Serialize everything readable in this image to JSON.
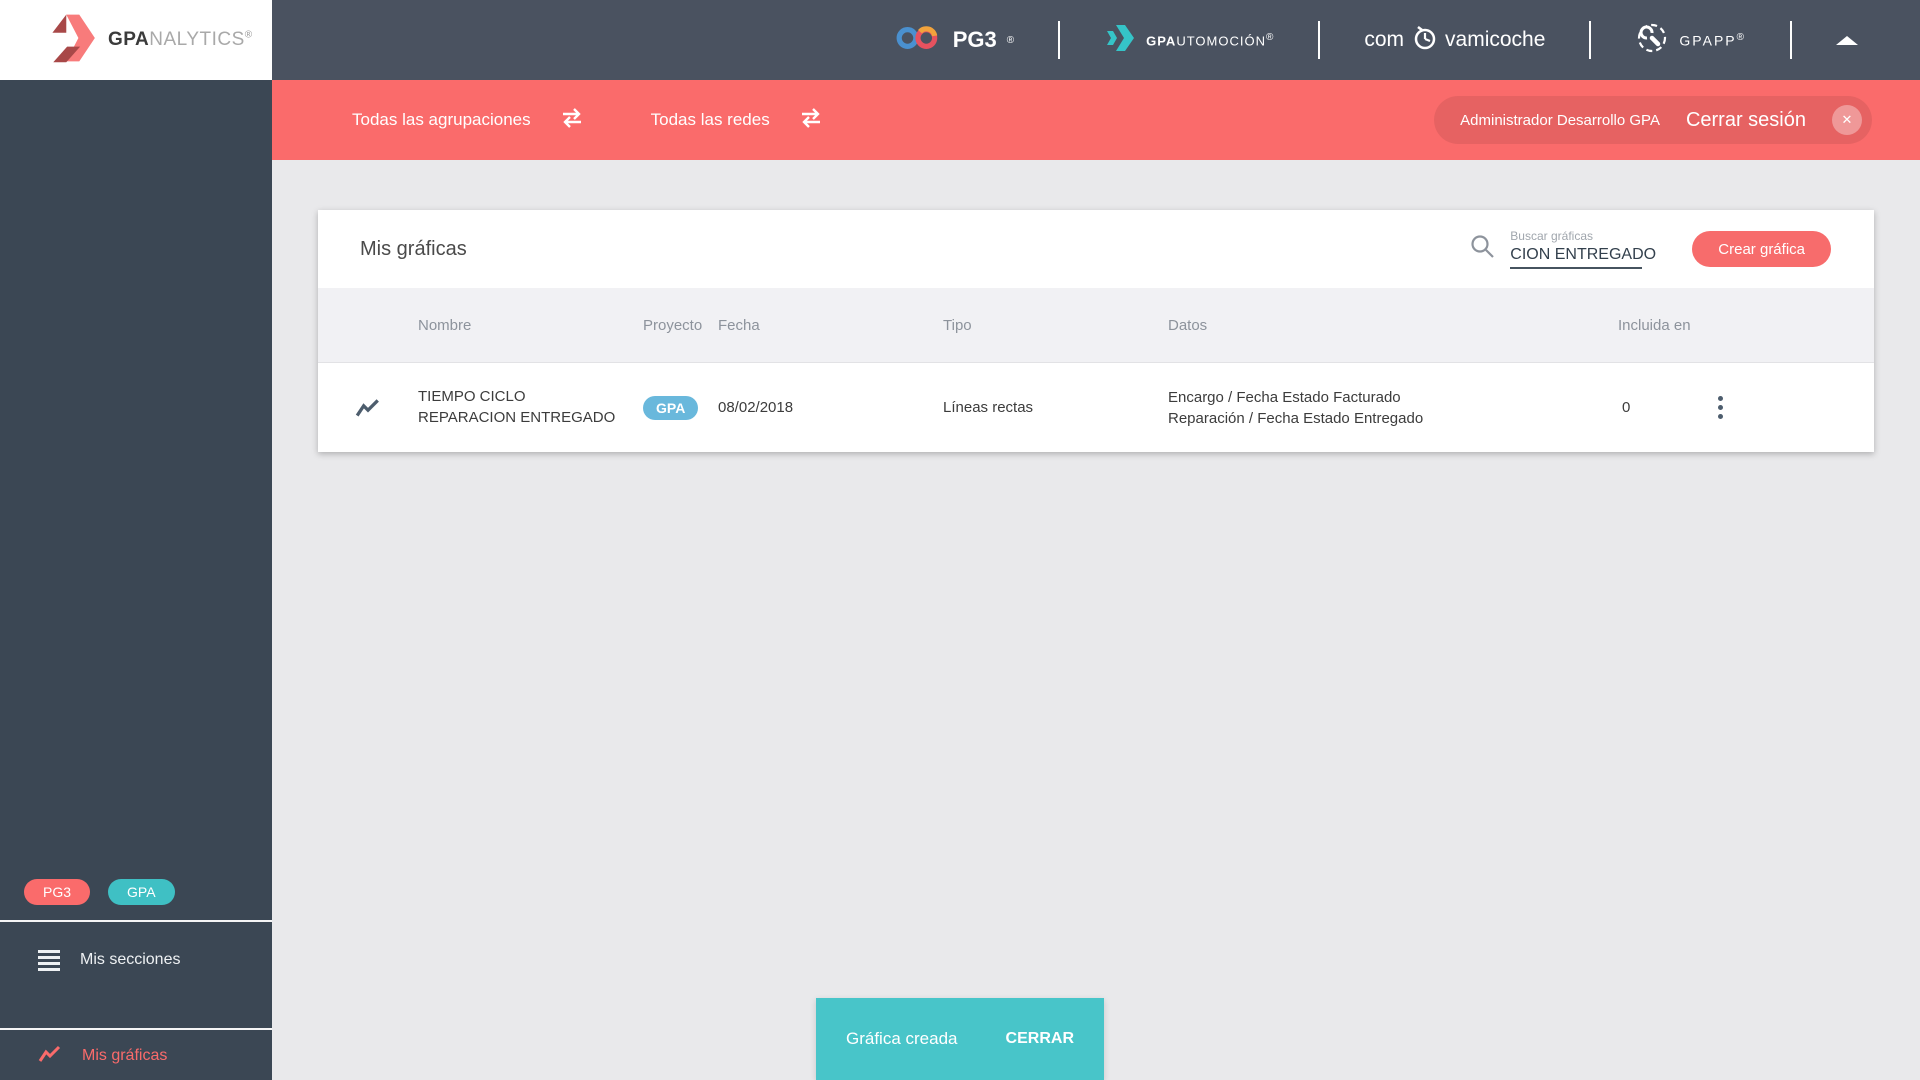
{
  "logo_box": {
    "bold": "GPA",
    "light": "NALYTICS",
    "registered": "®"
  },
  "topbar": {
    "pg3_label": "PG3",
    "pg3_registered": "®",
    "gpautomocion_bold": "GPA",
    "gpautomocion_rest": "UTOMOCIÓN",
    "gpautomocion_registered": "®",
    "comyovamicoche_prefix": "com",
    "comyovamicoche_suffix": "vamicoche",
    "gpapp_label": "GPAPP",
    "gpapp_registered": "®"
  },
  "filterbar": {
    "groupings": "Todas las agrupaciones",
    "networks": "Todas las redes",
    "user": "Administrador Desarrollo GPA",
    "logout": "Cerrar sesión",
    "close_glyph": "✕"
  },
  "sidebar": {
    "badge_pg3": "PG3",
    "badge_gpa": "GPA",
    "item_sections": "Mis secciones",
    "item_charts": "Mis gráficas"
  },
  "card": {
    "title": "Mis gráficas",
    "search": {
      "label": "Buscar gráficas",
      "value": "CION ENTREGADO"
    },
    "create_button": "Crear gráfica",
    "table": {
      "columns": [
        "Nombre",
        "Proyecto",
        "Fecha",
        "Tipo",
        "Datos",
        "Incluida en"
      ],
      "rows": [
        {
          "name": "TIEMPO CICLO REPARACION ENTREGADO",
          "project": "GPA",
          "date": "08/02/2018",
          "type": "Líneas rectas",
          "data_line1": "Encargo / Fecha Estado Facturado",
          "data_line2": "Reparación / Fecha Estado Entregado",
          "included_in": "0"
        }
      ]
    }
  },
  "toast": {
    "message": "Gráfica creada",
    "action": "CERRAR"
  },
  "colors": {
    "accent_red": "#fa6b6b",
    "toast_teal": "#48c5c9",
    "badge_blue": "#69b8dc",
    "badge_teal": "#3fc0c4",
    "topbar_bg": "#4a5260",
    "sidebar_bg": "#3b4754",
    "main_bg": "#e9e9eb",
    "table_header_bg": "#f1f1f4"
  }
}
